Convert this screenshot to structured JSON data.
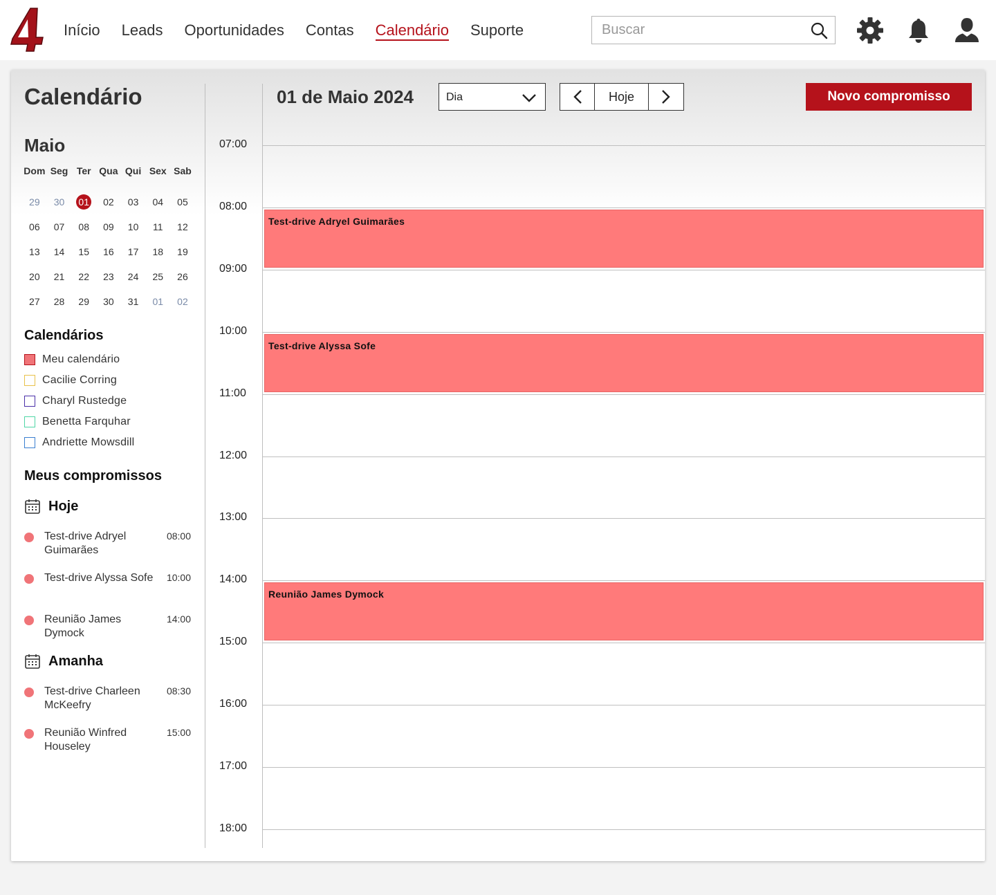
{
  "nav": {
    "items": [
      "Início",
      "Leads",
      "Oportunidades",
      "Contas",
      "Calendário",
      "Suporte"
    ],
    "active": "Calendário",
    "search_placeholder": "Buscar",
    "accent_color": "#b5121b"
  },
  "sidebar": {
    "title": "Calendário",
    "month": "Maio",
    "weekdays": [
      "Dom",
      "Seg",
      "Ter",
      "Qua",
      "Qui",
      "Sex",
      "Sab"
    ],
    "weeks": [
      [
        "29",
        "30",
        "01",
        "02",
        "03",
        "04",
        "05"
      ],
      [
        "06",
        "07",
        "08",
        "09",
        "10",
        "11",
        "12"
      ],
      [
        "13",
        "14",
        "15",
        "16",
        "17",
        "18",
        "19"
      ],
      [
        "20",
        "21",
        "22",
        "23",
        "24",
        "25",
        "26"
      ],
      [
        "27",
        "28",
        "29",
        "30",
        "31",
        "01",
        "02"
      ]
    ],
    "selected_day": "01",
    "calendars_title": "Calendários",
    "calendars": [
      {
        "label": "Meu calendário",
        "color": "#f07478",
        "checked": true
      },
      {
        "label": "Cacilie Corring",
        "color": "#e8c14a",
        "checked": false
      },
      {
        "label": "Charyl Rustedge",
        "color": "#4a2fa8",
        "checked": false
      },
      {
        "label": "Benetta Farquhar",
        "color": "#4fd6a6",
        "checked": false
      },
      {
        "label": "Andriette Mowsdill",
        "color": "#3a7fd0",
        "checked": false
      }
    ],
    "appointments_title": "Meus compromissos",
    "groups": [
      {
        "label": "Hoje",
        "items": [
          {
            "name": "Test-drive Adryel Guimarães",
            "time": "08:00"
          },
          {
            "name": "Test-drive Alyssa Sofe",
            "time": "10:00"
          },
          {
            "name": "Reunião James Dymock",
            "time": "14:00"
          }
        ]
      },
      {
        "label": "Amanha",
        "items": [
          {
            "name": "Test-drive Charleen McKeefry",
            "time": "08:30"
          },
          {
            "name": "Reunião Winfred Houseley",
            "time": "15:00"
          }
        ]
      }
    ]
  },
  "header": {
    "date_title": "01 de Maio 2024",
    "view": "Dia",
    "today_label": "Hoje",
    "new_button": "Novo compromisso"
  },
  "day_view": {
    "hours": [
      "07:00",
      "08:00",
      "09:00",
      "10:00",
      "11:00",
      "12:00",
      "13:00",
      "14:00",
      "15:00",
      "16:00",
      "17:00",
      "18:00"
    ],
    "events": [
      {
        "title": "Test-drive Adryel Guimarães",
        "start": "08:00",
        "color": "#ff7a7a"
      },
      {
        "title": "Test-drive Alyssa Sofe",
        "start": "10:00",
        "color": "#ff7a7a"
      },
      {
        "title": "Reunião James Dymock",
        "start": "14:00",
        "color": "#ff7a7a"
      }
    ]
  }
}
